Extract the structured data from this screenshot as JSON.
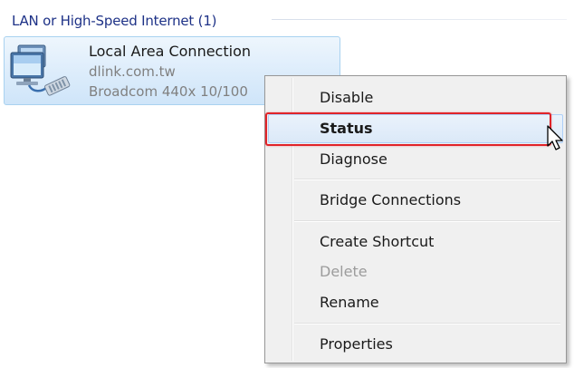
{
  "group": {
    "title": "LAN or High-Speed Internet (1)"
  },
  "connection": {
    "name": "Local Area Connection",
    "network": "dlink.com.tw",
    "adapter": "Broadcom 440x 10/100",
    "icon": "network-adapter-icon"
  },
  "context_menu": {
    "items": [
      {
        "label": "Disable",
        "bold": false,
        "disabled": false
      },
      {
        "label": "Status",
        "bold": true,
        "disabled": false
      },
      {
        "label": "Diagnose",
        "bold": false,
        "disabled": false
      },
      {
        "label": "Bridge Connections",
        "bold": false,
        "disabled": false
      },
      {
        "label": "Create Shortcut",
        "bold": false,
        "disabled": false
      },
      {
        "label": "Delete",
        "bold": false,
        "disabled": true
      },
      {
        "label": "Rename",
        "bold": false,
        "disabled": false
      },
      {
        "label": "Properties",
        "bold": false,
        "disabled": false
      }
    ],
    "highlighted_item": "Status"
  },
  "colors": {
    "group_title": "#1e3287",
    "highlight_outline": "#e0242a",
    "selection_border": "#a9d2f0"
  }
}
